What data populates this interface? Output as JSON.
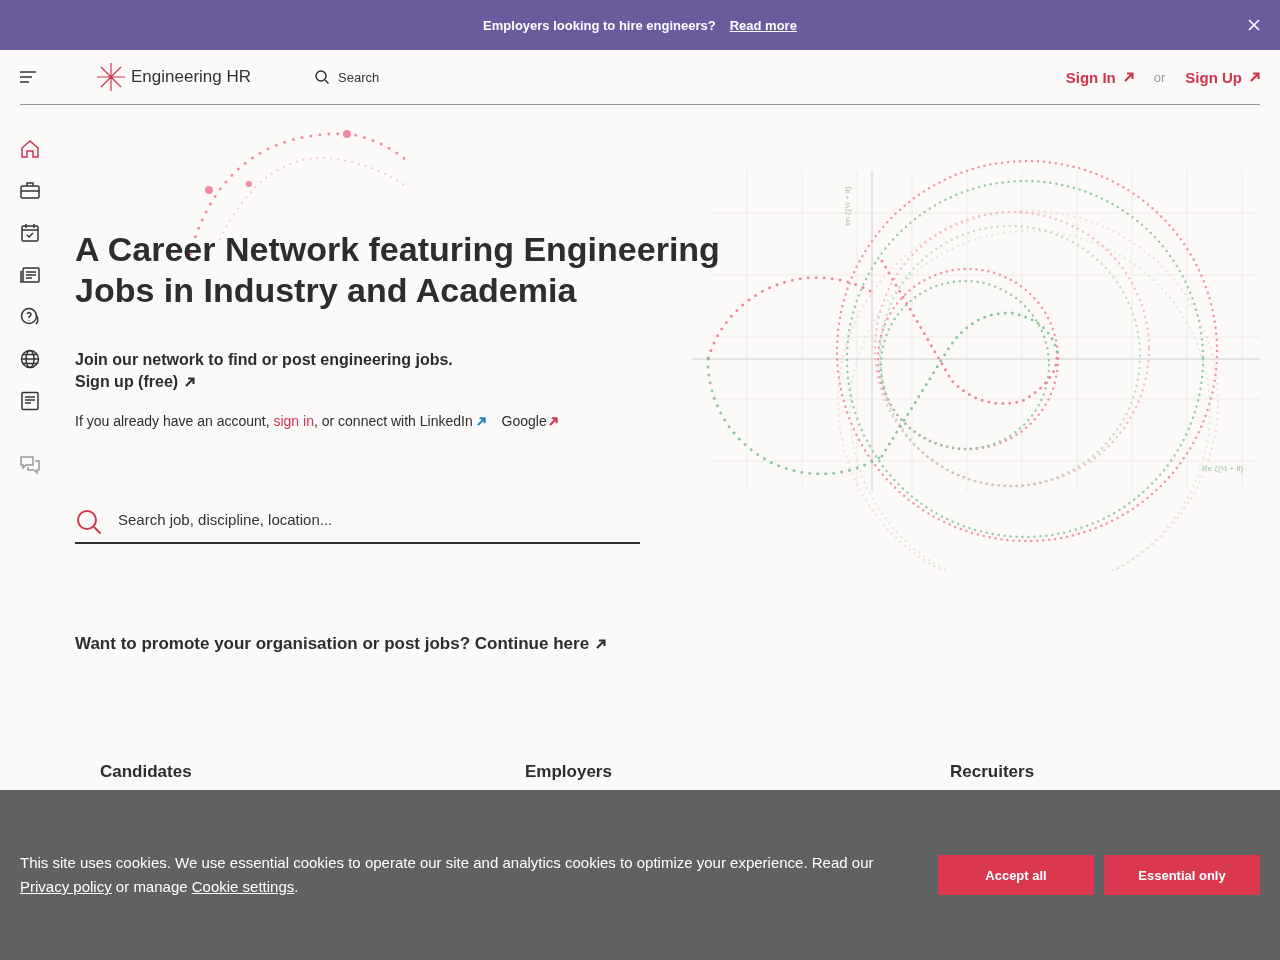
{
  "banner": {
    "text": "Employers looking to hire engineers?",
    "link": "Read more"
  },
  "header": {
    "logo": "Engineering HR",
    "search": "Search",
    "sign_in": "Sign In",
    "or": "or",
    "sign_up": "Sign Up"
  },
  "sidebar": {
    "items": [
      {
        "kind": "home",
        "selected": true
      },
      {
        "kind": "briefcase",
        "selected": false
      },
      {
        "kind": "calendar",
        "selected": false
      },
      {
        "kind": "news",
        "selected": false
      },
      {
        "kind": "help",
        "selected": false
      },
      {
        "kind": "globe",
        "selected": false
      },
      {
        "kind": "document",
        "selected": false
      },
      {
        "kind": "chat",
        "selected": false
      }
    ]
  },
  "hero": {
    "title_lines": [
      "A Career Network featuring Engineering",
      "Jobs in Industry and Academia"
    ],
    "lead": "Join our network to find or post engineering jobs.",
    "signup": "Sign up (free)",
    "account_before": "If you already have an account, ",
    "sign_in": "sign in",
    "account_after": ", or connect with ",
    "linkedin": "LinkedIn",
    "google": "Google",
    "search_placeholder": "Search job, discipline, location...",
    "promo": "Want to promote your organisation or post jobs? Continue here"
  },
  "plot": {
    "y_label": "Im ζ(½ + it)",
    "x_label": "Re ζ(½ + it)"
  },
  "cards": [
    {
      "title": "Candidates"
    },
    {
      "title": "Employers"
    },
    {
      "title": "Recruiters"
    }
  ],
  "cookie": {
    "text": "This site uses cookies. We use essential cookies to operate our site and analytics cookies to optimize your experience. Read our",
    "privacy": "Privacy policy",
    "middle": " or manage ",
    "settings": "Cookie settings",
    "end": ".",
    "buttons": [
      "Accept all",
      "Essential only"
    ]
  }
}
